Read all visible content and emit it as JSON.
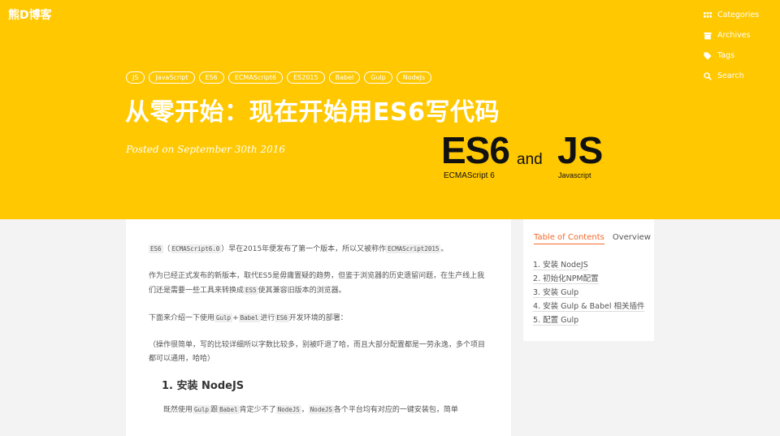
{
  "brand": "熊D博客",
  "nav": [
    {
      "label": "Categories",
      "icon": "grid-icon"
    },
    {
      "label": "Archives",
      "icon": "archive-icon"
    },
    {
      "label": "Tags",
      "icon": "tag-icon"
    },
    {
      "label": "Search",
      "icon": "search-icon"
    }
  ],
  "tags": [
    "JS",
    "JavaScript",
    "ES6",
    "ECMAScript6",
    "ES2015",
    "Babel",
    "Gulp",
    "NodeJs"
  ],
  "post": {
    "title": "从零开始：现在开始用ES6写代码",
    "date": "Posted on September 30th 2016"
  },
  "hero": {
    "es6": "ES6",
    "and": "and",
    "js": "JS",
    "ecma": "ECMAScript 6",
    "javascript": "Javascript"
  },
  "article": {
    "p1": {
      "c1": "ES6",
      "t1": "（",
      "c2": "ECMAScript6.0",
      "t2": "）早在2015年便发布了第一个版本，所以又被称作",
      "c3": "ECMAScript2015",
      "t3": "。"
    },
    "p2": {
      "t1": "作为已经正式发布的新版本，取代ES5是毋庸置疑的趋势，但鉴于浏览器的历史遗留问题，在生产线上我们还是需要一些工具来转换成",
      "c1": "ES5",
      "t2": "使其兼容旧版本的浏览器。"
    },
    "p3": {
      "t1": "下面来介绍一下使用",
      "c1": "Gulp",
      "t2": "+",
      "c2": "Babel",
      "t3": "进行",
      "c3": "ES6",
      "t4": "开发环境的部署："
    },
    "p4": "（操作很简单，写的比较详细所以字数比较多，别被吓退了哈，而且大部分配置都是一劳永逸，多个项目都可以通用，哈哈）",
    "h1": "1. 安装 NodeJS",
    "p5": {
      "t1": "既然使用",
      "c1": "Gulp",
      "t2": "跟",
      "c2": "Babel",
      "t3": "肯定少不了",
      "c3": "NodeJS",
      "t4": "，",
      "c4": "NodeJS",
      "t5": "各个平台均有对应的一键安装包，简单"
    }
  },
  "toc": {
    "tab_active": "Table of Contents",
    "tab_other": "Overview",
    "items": [
      "1. 安装 NodeJS",
      "2. 初始化NPM配置",
      "3. 安装 Gulp",
      "4. 安装 Gulp & Babel 相关插件",
      "5. 配置 Gulp"
    ]
  }
}
